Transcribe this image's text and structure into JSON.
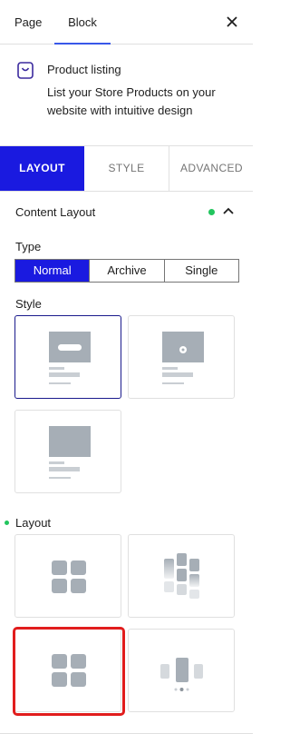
{
  "top_tabs": [
    {
      "label": "Page",
      "active": false
    },
    {
      "label": "Block",
      "active": true
    }
  ],
  "block": {
    "title": "Product listing",
    "description": "List your Store Products on your website with intuitive design",
    "icon": "shopping-bag-icon"
  },
  "subtabs": [
    {
      "label": "LAYOUT",
      "active": true
    },
    {
      "label": "STYLE",
      "active": false
    },
    {
      "label": "ADVANCED",
      "active": false
    }
  ],
  "section": {
    "title": "Content Layout",
    "modified": true,
    "expanded": true
  },
  "type": {
    "label": "Type",
    "options": [
      "Normal",
      "Archive",
      "Single"
    ],
    "selected": "Normal"
  },
  "style": {
    "label": "Style",
    "options": [
      "style-button-overlay",
      "style-icon-overlay",
      "style-plain"
    ],
    "selected": "style-button-overlay"
  },
  "layout": {
    "label": "Layout",
    "options": [
      "grid-2x2",
      "grid-columns-fade",
      "grid-2x2-compact",
      "carousel"
    ],
    "highlighted": "grid-2x2-compact"
  },
  "colors": {
    "accent": "#1a1ae0",
    "status_dot": "#22c55e",
    "highlight": "#e11d1d",
    "placeholder": "#a6aeb6"
  }
}
